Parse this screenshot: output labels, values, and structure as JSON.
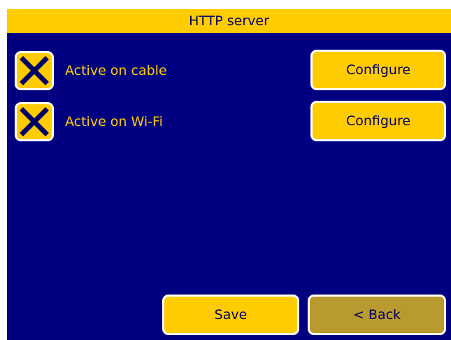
{
  "window": {
    "title": "HTTP server"
  },
  "rows": [
    {
      "label": "Active on cable",
      "checked": true,
      "configure_label": "Configure"
    },
    {
      "label": "Active on Wi-Fi",
      "checked": true,
      "configure_label": "Configure"
    }
  ],
  "footer": {
    "save_label": "Save",
    "back_label": "< Back"
  },
  "colors": {
    "background": "#000080",
    "accent": "#ffcc00",
    "accent_disabled": "#b89a2e",
    "text_dark": "#000066",
    "border": "#ffffff"
  },
  "icons": {
    "checkbox_mark": "x-mark-icon"
  }
}
